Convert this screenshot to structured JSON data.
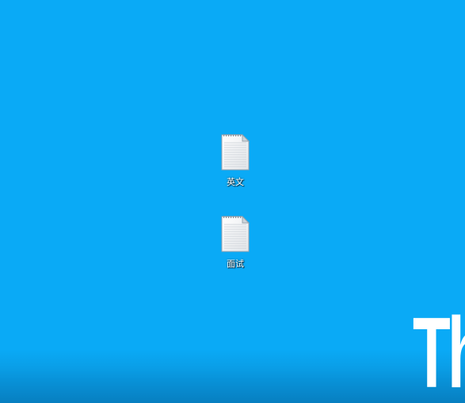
{
  "desktop": {
    "background_color": "#0aaaf6",
    "wallpaper_text": "Th",
    "icons": [
      {
        "label": "英文",
        "icon": "text-file-icon"
      },
      {
        "label": "面试",
        "icon": "text-file-icon"
      }
    ]
  }
}
